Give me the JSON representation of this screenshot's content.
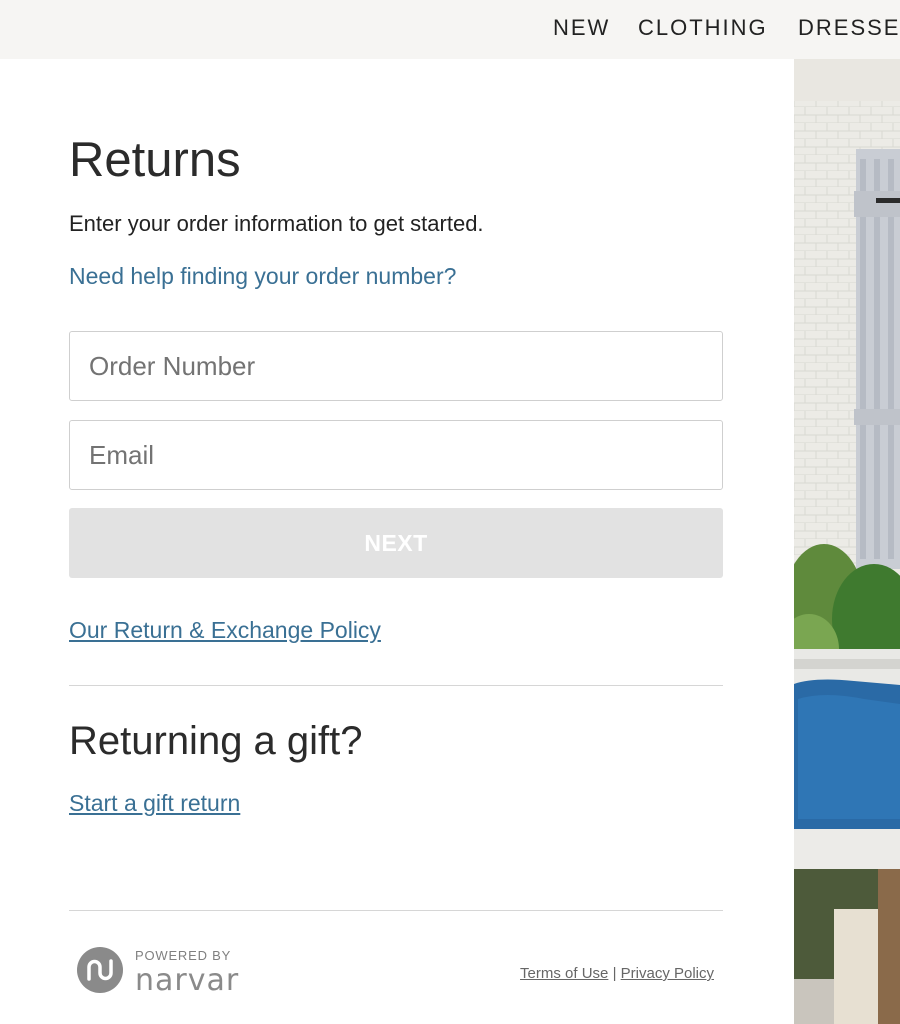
{
  "nav": {
    "items": [
      "NEW",
      "CLOTHING",
      "DRESSE"
    ]
  },
  "returns": {
    "title": "Returns",
    "intro": "Enter your order information to get started.",
    "help_link": "Need help finding your order number?",
    "order_placeholder": "Order Number",
    "email_placeholder": "Email",
    "next_label": "NEXT",
    "policy_link": "Our Return & Exchange Policy"
  },
  "gift": {
    "title": "Returning a gift?",
    "link": "Start a gift return"
  },
  "footer": {
    "powered_by": "POWERED BY",
    "brand": "narvar",
    "terms": "Terms of Use",
    "separator": "|",
    "privacy": "Privacy Policy"
  },
  "colors": {
    "link": "#3a7094",
    "button_disabled": "#e2e2e2",
    "nav_bg": "#f6f5f3"
  },
  "icons": {
    "brand_logo": "narvar-logo-icon"
  }
}
